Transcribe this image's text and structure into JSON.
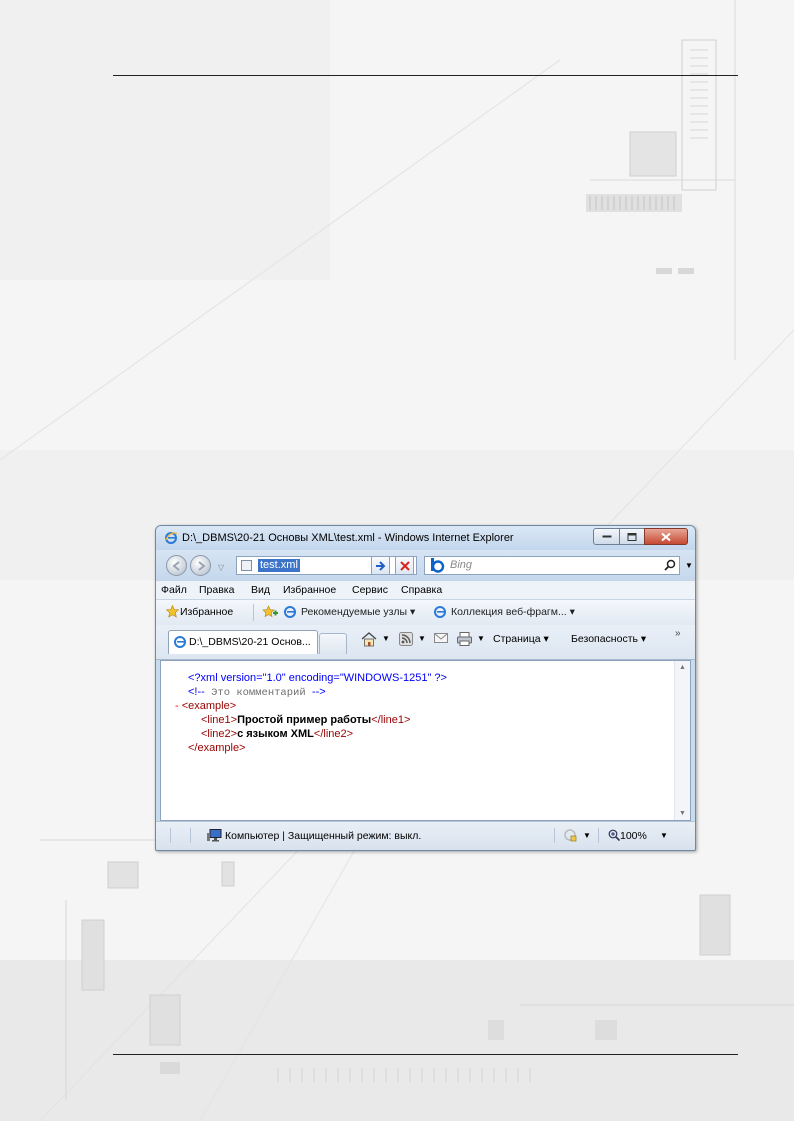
{
  "window": {
    "title": "D:\\_DBMS\\20-21 Основы XML\\test.xml - Windows Internet Explorer"
  },
  "navbar": {
    "address_value": "test.xml",
    "search_placeholder": "Bing"
  },
  "menu": {
    "items": [
      {
        "label": "Файл"
      },
      {
        "label": "Правка"
      },
      {
        "label": "Вид"
      },
      {
        "label": "Избранное"
      },
      {
        "label": "Сервис"
      },
      {
        "label": "Справка"
      }
    ]
  },
  "favorites_bar": {
    "favorites_label": "Избранное",
    "links": [
      {
        "label": "Рекомендуемые узлы ▾"
      },
      {
        "label": "Коллекция веб-фрагм... ▾"
      }
    ]
  },
  "tabs": {
    "active_tab_label": "D:\\_DBMS\\20-21 Основ..."
  },
  "command_bar": {
    "page_label": "Страница ▾",
    "safety_label": "Безопасность ▾",
    "chevron": "»"
  },
  "document": {
    "line_decl": "<?xml version=\"1.0\" encoding=\"WINDOWS-1251\" ?>",
    "comment_open": "<!--",
    "comment_text": " Это комментарий ",
    "comment_close": "-->",
    "collapse_marker": "-",
    "example_open": "<example>",
    "line1_open": "<line1>",
    "line1_text": "Простой пример работы",
    "line1_close": "</line1>",
    "line2_open": "<line2>",
    "line2_text": "с языком XML",
    "line2_close": "</line2>",
    "example_close": "</example>"
  },
  "statusbar": {
    "zone_text": "Компьютер | Защищенный режим: выкл.",
    "zoom": "100%"
  }
}
